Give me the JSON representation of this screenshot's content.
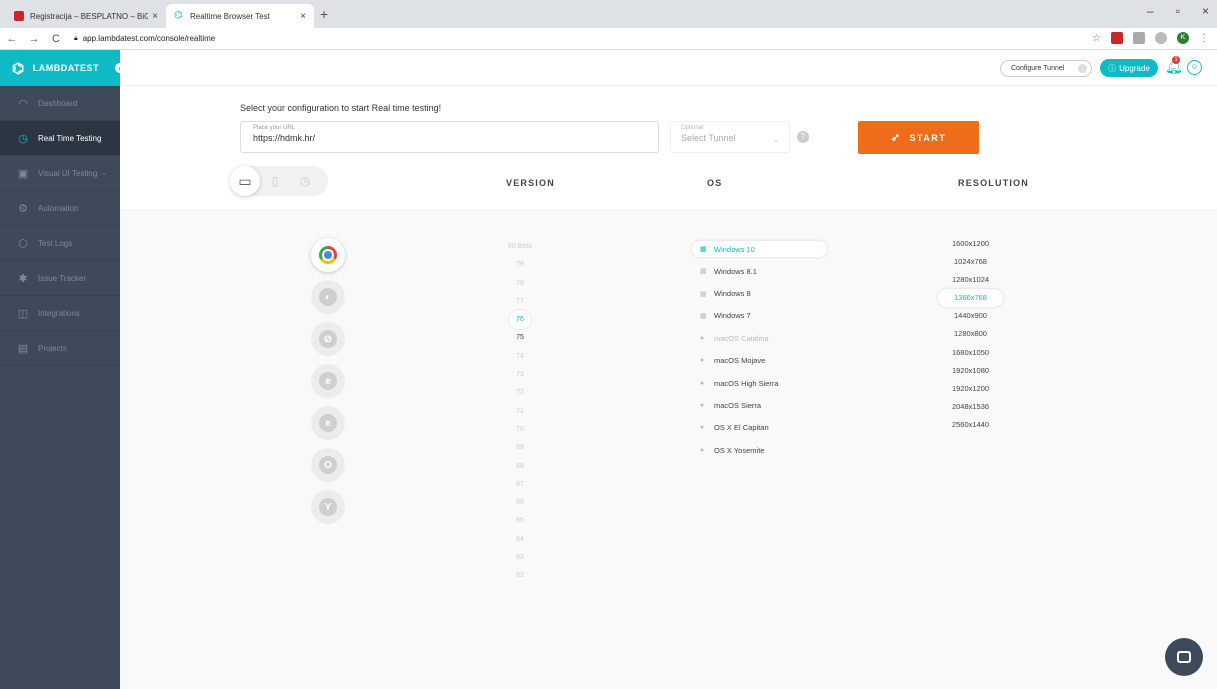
{
  "browser_chrome": {
    "tabs": [
      {
        "title": "Registracija – BESPLATNO – BiG",
        "active": false
      },
      {
        "title": "Realtime Browser Test",
        "active": true
      }
    ],
    "new_tab": "+",
    "url": "app.lambdatest.com/console/realtime",
    "window_controls": [
      "–",
      "▫",
      "×"
    ],
    "profile_initial": "K"
  },
  "sidebar": {
    "brand": "LAMBDATEST",
    "items": [
      {
        "label": "Dashboard",
        "icon": "dashboard-icon",
        "active": false
      },
      {
        "label": "Real Time Testing",
        "icon": "clock-icon",
        "active": true
      },
      {
        "label": "Visual UI Testing",
        "icon": "screen-icon",
        "active": false,
        "expandable": true
      },
      {
        "label": "Automation",
        "icon": "robot-icon",
        "active": false
      },
      {
        "label": "Test Logs",
        "icon": "logs-icon",
        "active": false
      },
      {
        "label": "Issue Tracker",
        "icon": "bug-icon",
        "active": false
      },
      {
        "label": "Integrations",
        "icon": "integrations-icon",
        "active": false
      },
      {
        "label": "Projects",
        "icon": "folder-icon",
        "active": false
      }
    ]
  },
  "topbar": {
    "configure_tunnel": "Configure Tunnel",
    "upgrade": "Upgrade",
    "notification_count": "1"
  },
  "config": {
    "prompt": "Select your configuration to start Real time testing!",
    "url_label": "Place your URL",
    "url_value": "https://hdmk.hr/",
    "tunnel_label": "Optional",
    "tunnel_placeholder": "Select Tunnel",
    "help": "?",
    "start_label": "START"
  },
  "columns": {
    "version": "VERSION",
    "os": "OS",
    "resolution": "RESOLUTION"
  },
  "browsers": [
    {
      "name": "chrome-icon",
      "glyph": "",
      "active": true
    },
    {
      "name": "firefox-icon",
      "glyph": "◐"
    },
    {
      "name": "safari-icon",
      "glyph": "⊘"
    },
    {
      "name": "ie-icon",
      "glyph": "e"
    },
    {
      "name": "edge-icon",
      "glyph": "e"
    },
    {
      "name": "opera-icon",
      "glyph": "O"
    },
    {
      "name": "yandex-icon",
      "glyph": "Y"
    }
  ],
  "versions": [
    {
      "v": "80 Beta",
      "state": "disabled"
    },
    {
      "v": "79",
      "state": "disabled"
    },
    {
      "v": "78",
      "state": "disabled"
    },
    {
      "v": "77",
      "state": "disabled"
    },
    {
      "v": "76",
      "state": "active"
    },
    {
      "v": "75",
      "state": "enabled"
    },
    {
      "v": "74",
      "state": "disabled"
    },
    {
      "v": "73",
      "state": "disabled"
    },
    {
      "v": "72",
      "state": "disabled"
    },
    {
      "v": "71",
      "state": "disabled"
    },
    {
      "v": "70",
      "state": "disabled"
    },
    {
      "v": "69",
      "state": "disabled"
    },
    {
      "v": "68",
      "state": "disabled"
    },
    {
      "v": "67",
      "state": "disabled"
    },
    {
      "v": "66",
      "state": "disabled"
    },
    {
      "v": "65",
      "state": "disabled"
    },
    {
      "v": "64",
      "state": "disabled"
    },
    {
      "v": "63",
      "state": "disabled"
    },
    {
      "v": "62",
      "state": "disabled"
    }
  ],
  "os": [
    {
      "name": "Windows 10",
      "icon": "windows-icon",
      "state": "active"
    },
    {
      "name": "Windows 8.1",
      "icon": "windows-icon",
      "state": "enabled"
    },
    {
      "name": "Windows 8",
      "icon": "windows-icon",
      "state": "enabled"
    },
    {
      "name": "Windows 7",
      "icon": "windows-icon",
      "state": "enabled"
    },
    {
      "name": "macOS Catalina",
      "icon": "apple-icon",
      "state": "disabled"
    },
    {
      "name": "macOS Mojave",
      "icon": "apple-icon",
      "state": "enabled"
    },
    {
      "name": "macOS High Sierra",
      "icon": "apple-icon",
      "state": "enabled"
    },
    {
      "name": "macOS Sierra",
      "icon": "apple-icon",
      "state": "enabled"
    },
    {
      "name": "OS X El Capitan",
      "icon": "apple-icon",
      "state": "enabled"
    },
    {
      "name": "OS X Yosemite",
      "icon": "apple-icon",
      "state": "enabled"
    }
  ],
  "resolutions": [
    {
      "r": "1600x1200",
      "state": "enabled"
    },
    {
      "r": "1024x768",
      "state": "enabled"
    },
    {
      "r": "1280x1024",
      "state": "enabled"
    },
    {
      "r": "1366x768",
      "state": "active"
    },
    {
      "r": "1440x900",
      "state": "enabled"
    },
    {
      "r": "1280x800",
      "state": "enabled"
    },
    {
      "r": "1680x1050",
      "state": "enabled"
    },
    {
      "r": "1920x1080",
      "state": "enabled"
    },
    {
      "r": "1920x1200",
      "state": "enabled"
    },
    {
      "r": "2048x1536",
      "state": "enabled"
    },
    {
      "r": "2560x1440",
      "state": "enabled"
    }
  ],
  "colors": {
    "accent": "#0ebac5",
    "start": "#ef6c1a",
    "sidebar": "#3e4a5a"
  }
}
